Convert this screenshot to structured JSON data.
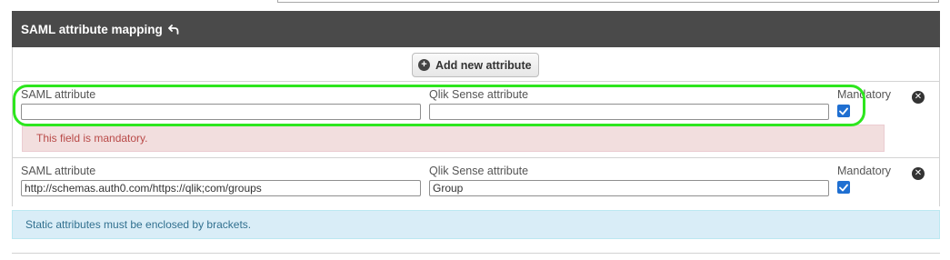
{
  "panel": {
    "title": "SAML attribute mapping",
    "title_icon": "undo-icon"
  },
  "toolbar": {
    "add_label": "Add new attribute",
    "add_icon": "plus-circle-icon"
  },
  "rows": [
    {
      "saml_label": "SAML attribute",
      "saml_value": "",
      "qlik_label": "Qlik Sense attribute",
      "qlik_value": "",
      "mandatory_label": "Mandatory",
      "mandatory_checked": true,
      "error": "This field is mandatory.",
      "highlighted": true
    },
    {
      "saml_label": "SAML attribute",
      "saml_value": "http://schemas.auth0.com/https://qlik;com/groups",
      "qlik_label": "Qlik Sense attribute",
      "qlik_value": "Group",
      "mandatory_label": "Mandatory",
      "mandatory_checked": true
    }
  ],
  "info": {
    "text": "Static attributes must be enclosed by brackets."
  },
  "colors": {
    "header_bg": "#4a4a4a",
    "highlight": "#2ee61e",
    "checkbox": "#1f6fd1",
    "error_bg": "#f2dede",
    "error_text": "#b94a48",
    "info_bg": "#d9edf7",
    "info_text": "#31708f"
  }
}
